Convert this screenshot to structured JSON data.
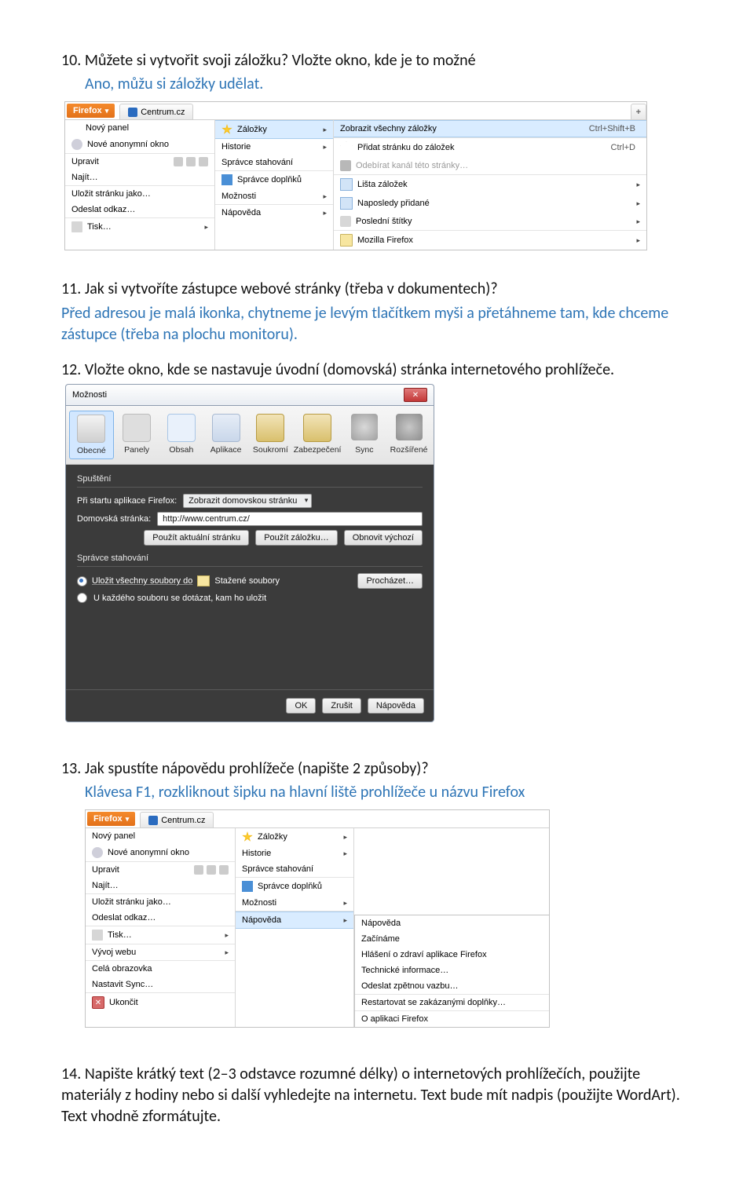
{
  "q10": "10. Můžete si vytvořit svoji záložku? Vložte okno, kde je to možné",
  "a10": "Ano, můžu si záložky udělat.",
  "q11": "11. Jak si vytvoříte zástupce webové stránky (třeba v dokumentech)?",
  "a11": "Před adresou je malá ikonka, chytneme je levým tlačítkem myši a přetáhneme tam, kde chceme zástupce (třeba na plochu monitoru).",
  "q12": "12. Vložte okno, kde se nastavuje úvodní (domovská) stránka internetového prohlížeče.",
  "q13": "13. Jak spustíte nápovědu prohlížeče (napište 2 způsoby)?",
  "a13": "Klávesa F1, rozkliknout šipku na hlavní liště prohlížeče u názvu Firefox",
  "q14": "14. Napište krátký text (2–3 odstavce rozumné délky) o internetových prohlížečích, použijte materiály z hodiny nebo si další vyhledejte na internetu. Text bude mít nadpis (použijte WordArt).  Text vhodně zformátujte.",
  "ff_label": "Firefox",
  "tab_centrum": "Centrum.cz",
  "plus": "+",
  "menu1": {
    "col1": [
      "Nový panel",
      "Nové anonymní okno",
      "Upravit",
      "Najít…",
      "Uložit stránku jako…",
      "Odeslat odkaz…",
      "Tisk…"
    ],
    "col2": [
      "Záložky",
      "Historie",
      "Správce stahování",
      "Správce doplňků",
      "Možnosti",
      "Nápověda"
    ],
    "col3": [
      {
        "l": "Zobrazit všechny záložky",
        "s": "Ctrl+Shift+B"
      },
      {
        "l": "Přidat stránku do záložek",
        "s": "Ctrl+D"
      },
      {
        "l": "Odebírat kanál této stránky…",
        "s": ""
      },
      {
        "l": "Lišta záložek",
        "s": "▸"
      },
      {
        "l": "Naposledy přidané",
        "s": "▸"
      },
      {
        "l": "Poslední štítky",
        "s": "▸"
      },
      {
        "l": "Mozilla Firefox",
        "s": "▸"
      }
    ]
  },
  "opts": {
    "title": "Možnosti",
    "tabs": [
      "Obecné",
      "Panely",
      "Obsah",
      "Aplikace",
      "Soukromí",
      "Zabezpečení",
      "Sync",
      "Rozšířené"
    ],
    "sect_start": "Spuštění",
    "start_lbl": "Při startu aplikace Firefox:",
    "start_val": "Zobrazit domovskou stránku",
    "home_lbl": "Domovská stránka:",
    "home_val": "http://www.centrum.cz/",
    "btn_cur": "Použít aktuální stránku",
    "btn_bm": "Použít záložku…",
    "btn_def": "Obnovit výchozí",
    "sect_dl": "Správce stahování",
    "r1": "Uložit všechny soubory do",
    "r1_folder": "Stažené soubory",
    "btn_browse": "Procházet…",
    "r2": "U každého souboru se dotázat, kam ho uložit",
    "ok": "OK",
    "cancel": "Zrušit",
    "help": "Nápověda"
  },
  "menu3": {
    "col1": [
      "Nový panel",
      "Nové anonymní okno",
      "Upravit",
      "Najít…",
      "Uložit stránku jako…",
      "Odeslat odkaz…",
      "Tisk…",
      "Vývoj webu",
      "Celá obrazovka",
      "Nastavit Sync…",
      "Ukončit"
    ],
    "col2": [
      "Záložky",
      "Historie",
      "Správce stahování",
      "Správce doplňků",
      "Možnosti",
      "Nápověda"
    ],
    "col3": [
      "Nápověda",
      "Začínáme",
      "Hlášení o zdraví aplikace Firefox",
      "Technické informace…",
      "Odeslat zpětnou vazbu…",
      "Restartovat se zakázanými doplňky…",
      "O aplikaci Firefox"
    ]
  }
}
